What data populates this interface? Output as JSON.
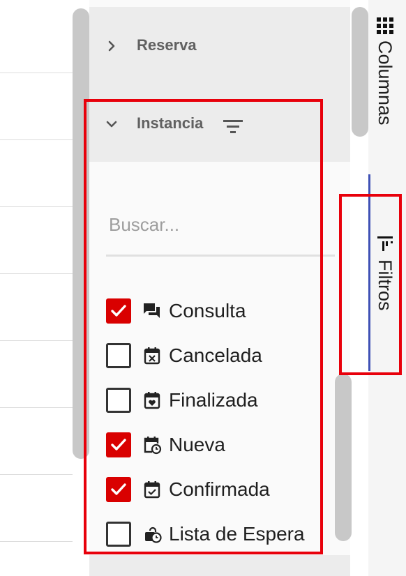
{
  "groups": [
    {
      "label": "Reserva",
      "expanded": false
    },
    {
      "label": "Instancia",
      "expanded": true
    }
  ],
  "search": {
    "placeholder": "Buscar...",
    "value": ""
  },
  "options": [
    {
      "label": "Consulta",
      "checked": true,
      "icon": "chat-icon"
    },
    {
      "label": "Cancelada",
      "checked": false,
      "icon": "calendar-x-icon"
    },
    {
      "label": "Finalizada",
      "checked": false,
      "icon": "calendar-heart-icon"
    },
    {
      "label": "Nueva",
      "checked": true,
      "icon": "calendar-clock-icon"
    },
    {
      "label": "Confirmada",
      "checked": true,
      "icon": "calendar-check-icon"
    },
    {
      "label": "Lista de Espera",
      "checked": false,
      "icon": "clock-lock-icon"
    }
  ],
  "side_tabs": {
    "columns": {
      "label": "Columnas",
      "icon": "grid-icon"
    },
    "filters": {
      "label": "Filtros",
      "icon": "filter-icon",
      "active": true
    }
  },
  "colors": {
    "checked": "#d90000",
    "highlight": "#e8000b",
    "active_tab": "#3f51b5"
  }
}
